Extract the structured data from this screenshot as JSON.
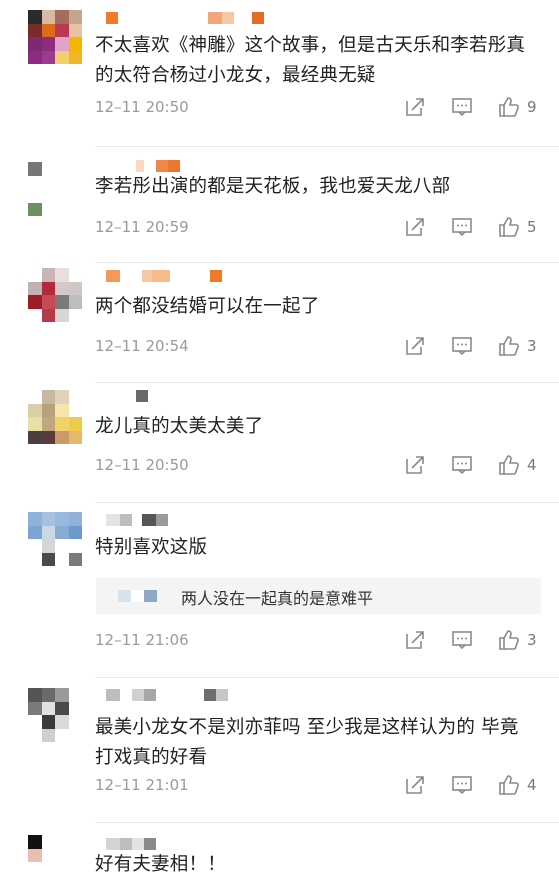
{
  "comments": [
    {
      "text": "不太喜欢《神雕》这个故事，但是古天乐和李若彤真的太符合杨过小龙女，最经典无疑",
      "time": "12–11 20:50",
      "likes": "9",
      "avatar": [
        "#2b2b2b",
        "#d9b9a6",
        "#a66b5a",
        "#c9a48c",
        "#7a2a2a",
        "#e06a1c",
        "#b93a56",
        "#e7c3a1",
        "#7b2b6e",
        "#8c2e80",
        "#e2a3c8",
        "#f4b400",
        "#8a2c82",
        "#9b3b8c",
        "#efd06a",
        "#f2b52a"
      ],
      "name": [
        "#f07a2a",
        "#ffffff",
        "#ffffff",
        "#ffffff",
        "#ffffff",
        "#f2a679",
        "#f6c7a6",
        "#ffffff",
        "#e86a2a"
      ]
    },
    {
      "text": "李若彤出演的都是天花板，我也爱天龙八部",
      "time": "12–11 20:59",
      "likes": "5",
      "avatar": [
        "#777777",
        "#ffffff",
        "#ffffff",
        "#ffffff",
        "#ffffff",
        "#ffffff",
        "#ffffff",
        "#ffffff",
        "#ffffff",
        "#ffffff",
        "#ffffff",
        "#ffffff",
        "#6f8f62",
        "#ffffff",
        "#ffffff",
        "#ffffff"
      ],
      "name": [
        "#ffffff",
        "#ffffff",
        "#fbd8c4",
        "#ffffff",
        "#f0884a",
        "#e9782c"
      ]
    },
    {
      "text": "两个都没结婚可以在一起了",
      "time": "12–11 20:54",
      "likes": "3",
      "avatar": [
        "#ffffff",
        "#c9b5b5",
        "#e8dede",
        "#ffffff",
        "#c3b0b0",
        "#b3283a",
        "#d4c9c9",
        "#d0c6c6",
        "#9e1b2a",
        "#c84a55",
        "#7a7a7a",
        "#bdbdbd",
        "#ffffff",
        "#b33a48",
        "#d6d6d6",
        "#ffffff"
      ],
      "name": [
        "#f39a5a",
        "#ffffff",
        "#f6c8a6",
        "#f7bb8c",
        "#ffffff",
        "#ffffff",
        "#f07a2a"
      ]
    },
    {
      "text": "龙儿真的太美太美了",
      "time": "12–11 20:50",
      "likes": "4",
      "avatar": [
        "#ffffff",
        "#c6b9a2",
        "#e0d3bb",
        "#ffffff",
        "#d9cfa6",
        "#b9a27a",
        "#f4e6a8",
        "#ffffff",
        "#e9dfa0",
        "#bfa780",
        "#f2d36a",
        "#eecb4a",
        "#4a4040",
        "#5a3a3a",
        "#c99a6a",
        "#e7b76a"
      ],
      "name": [
        "#ffffff",
        "#6a6a6a"
      ]
    },
    {
      "text": "特别喜欢这版",
      "time": "12–11 21:06",
      "likes": "3",
      "avatar": [
        "#8cb3dc",
        "#a6c1e2",
        "#9ab8de",
        "#8fb1da",
        "#7ea4d3",
        "#c9d7e6",
        "#88aad4",
        "#6e99cc",
        "#ffffff",
        "#d6d6d6",
        "#ffffff",
        "#ffffff",
        "#ffffff",
        "#4a4a4a",
        "#ffffff",
        "#7a7a7a"
      ],
      "name": [
        "#e4e4e4",
        "#bdbdbd",
        "#ffffff",
        "#555555",
        "#9a9a9a"
      ],
      "reply": {
        "text": "两人没在一起真的是意难平",
        "pix": [
          "#d8e2ee",
          "#ffffff",
          "#8fa8c8"
        ]
      }
    },
    {
      "text": "最美小龙女不是刘亦菲吗 至少我是这样认为的 毕竟打戏真的好看",
      "time": "12–11 21:01",
      "likes": "4",
      "avatar": [
        "#555555",
        "#6a6a6a",
        "#9a9a9a",
        "#ffffff",
        "#7a7a7a",
        "#e0e0e0",
        "#4a4a4a",
        "#ffffff",
        "#ffffff",
        "#3a3a3a",
        "#d9d9d9",
        "#ffffff",
        "#ffffff",
        "#cfcfcf",
        "#ffffff",
        "#ffffff"
      ],
      "name": [
        "#bdbdbd",
        "#ffffff",
        "#d0d0d0",
        "#a6a6a6",
        "#ffffff",
        "#ffffff",
        "#6e6e6e",
        "#c6c6c6"
      ]
    },
    {
      "text": "好有夫妻相！！",
      "time": "",
      "likes": "",
      "avatar": [
        "#111111",
        "#ffffff",
        "#ffffff",
        "#ffffff",
        "#e8c0b0",
        "#ffffff",
        "#ffffff",
        "#ffffff",
        "#ffffff",
        "#ffffff",
        "#ffffff",
        "#ffffff",
        "#ffffff",
        "#ffffff",
        "#ffffff",
        "#ffffff"
      ],
      "name": [
        "#d4d4d4",
        "#bdbdbd",
        "#e2e2e2",
        "#8a8a8a"
      ]
    }
  ],
  "icons": {
    "share": "share-icon",
    "comment": "comment-icon",
    "like": "like-icon"
  },
  "colors": {
    "text": "#222222",
    "meta": "#9a9a9a",
    "divider": "#ececec",
    "reply_bg": "#f4f4f4"
  }
}
